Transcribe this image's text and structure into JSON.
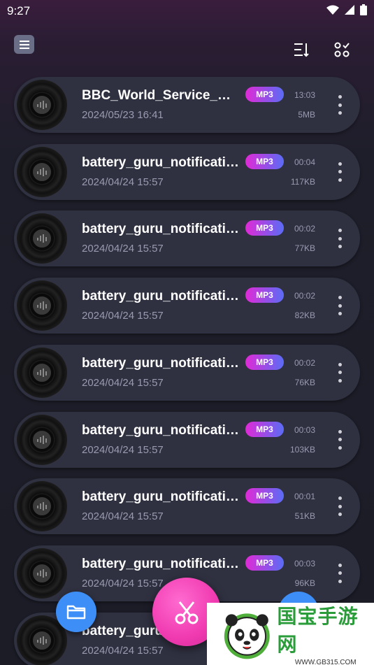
{
  "status_bar": {
    "time": "9:27"
  },
  "toolbar": {
    "menu_icon": "menu-icon",
    "sort_icon": "sort-icon",
    "select_icon": "multi-select-icon"
  },
  "files": [
    {
      "name": "BBC_World_Service_BBC_Newshour",
      "date": "2024/05/23 16:41",
      "format": "MP3",
      "duration": "13:03",
      "size": "5MB"
    },
    {
      "name": "battery_guru_notification_sound",
      "date": "2024/04/24 15:57",
      "format": "MP3",
      "duration": "00:04",
      "size": "117KB"
    },
    {
      "name": "battery_guru_notification_sound",
      "date": "2024/04/24 15:57",
      "format": "MP3",
      "duration": "00:02",
      "size": "77KB"
    },
    {
      "name": "battery_guru_notification_sound",
      "date": "2024/04/24 15:57",
      "format": "MP3",
      "duration": "00:02",
      "size": "82KB"
    },
    {
      "name": "battery_guru_notification_sound",
      "date": "2024/04/24 15:57",
      "format": "MP3",
      "duration": "00:02",
      "size": "76KB"
    },
    {
      "name": "battery_guru_notification_sound",
      "date": "2024/04/24 15:57",
      "format": "MP3",
      "duration": "00:03",
      "size": "103KB"
    },
    {
      "name": "battery_guru_notification_sound",
      "date": "2024/04/24 15:57",
      "format": "MP3",
      "duration": "00:01",
      "size": "51KB"
    },
    {
      "name": "battery_guru_notification_sound",
      "date": "2024/04/24 15:57",
      "format": "MP3",
      "duration": "00:03",
      "size": "96KB"
    },
    {
      "name": "battery_guru_notification_sound",
      "date": "2024/04/24 15:57",
      "format": "",
      "duration": "",
      "size": ""
    }
  ],
  "fabs": {
    "folder_icon": "folder-icon",
    "cut_icon": "scissors-icon"
  },
  "watermark": {
    "title": "国宝手游网",
    "url": "WWW.GB315.COM"
  },
  "colors": {
    "badge_start": "#e02ad6",
    "badge_end": "#5a6cf5",
    "cut_fab": "#f03ab0",
    "folder_fab": "#3d8ff7"
  }
}
